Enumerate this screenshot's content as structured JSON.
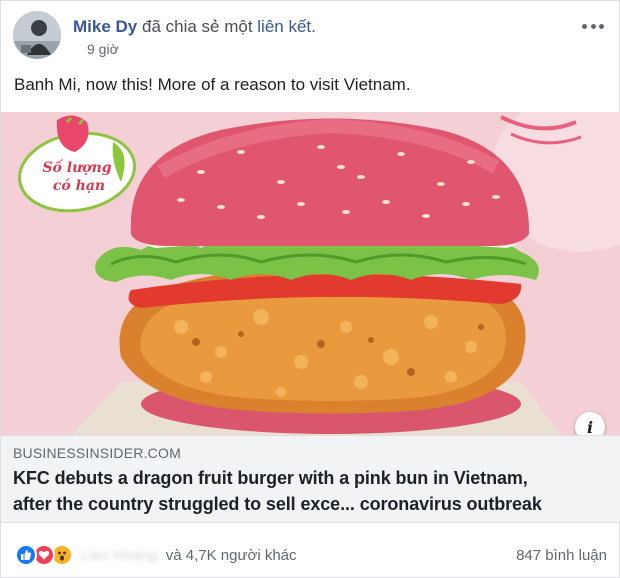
{
  "post": {
    "author": "Mike Dy",
    "share_text": "đã chia sẻ một",
    "share_link": "liên kết.",
    "timestamp": "9 giờ",
    "message": "Banh Mi, now this! More of a reason to visit Vietnam."
  },
  "link": {
    "image_badge_line1": "Số lượng",
    "image_badge_line2": "có hạn",
    "domain": "BUSINESSINSIDER.COM",
    "title_line1": "KFC debuts a dragon fruit burger with a pink bun in Vietnam,",
    "title_line2": "after the country struggled to sell exce... coronavirus outbreak"
  },
  "footer": {
    "reactor_name": "Lien Hoang",
    "reaction_count_text": "và 4,7K người khác",
    "comments_count": "847 bình luận",
    "reaction_icons": [
      "like-icon",
      "love-icon",
      "wow-icon"
    ]
  },
  "colors": {
    "link_blue": "#385898",
    "like_blue": "#1877f2",
    "love_red": "#f33e58",
    "wow_yellow": "#f7b125",
    "bun_pink": "#e0566f"
  }
}
